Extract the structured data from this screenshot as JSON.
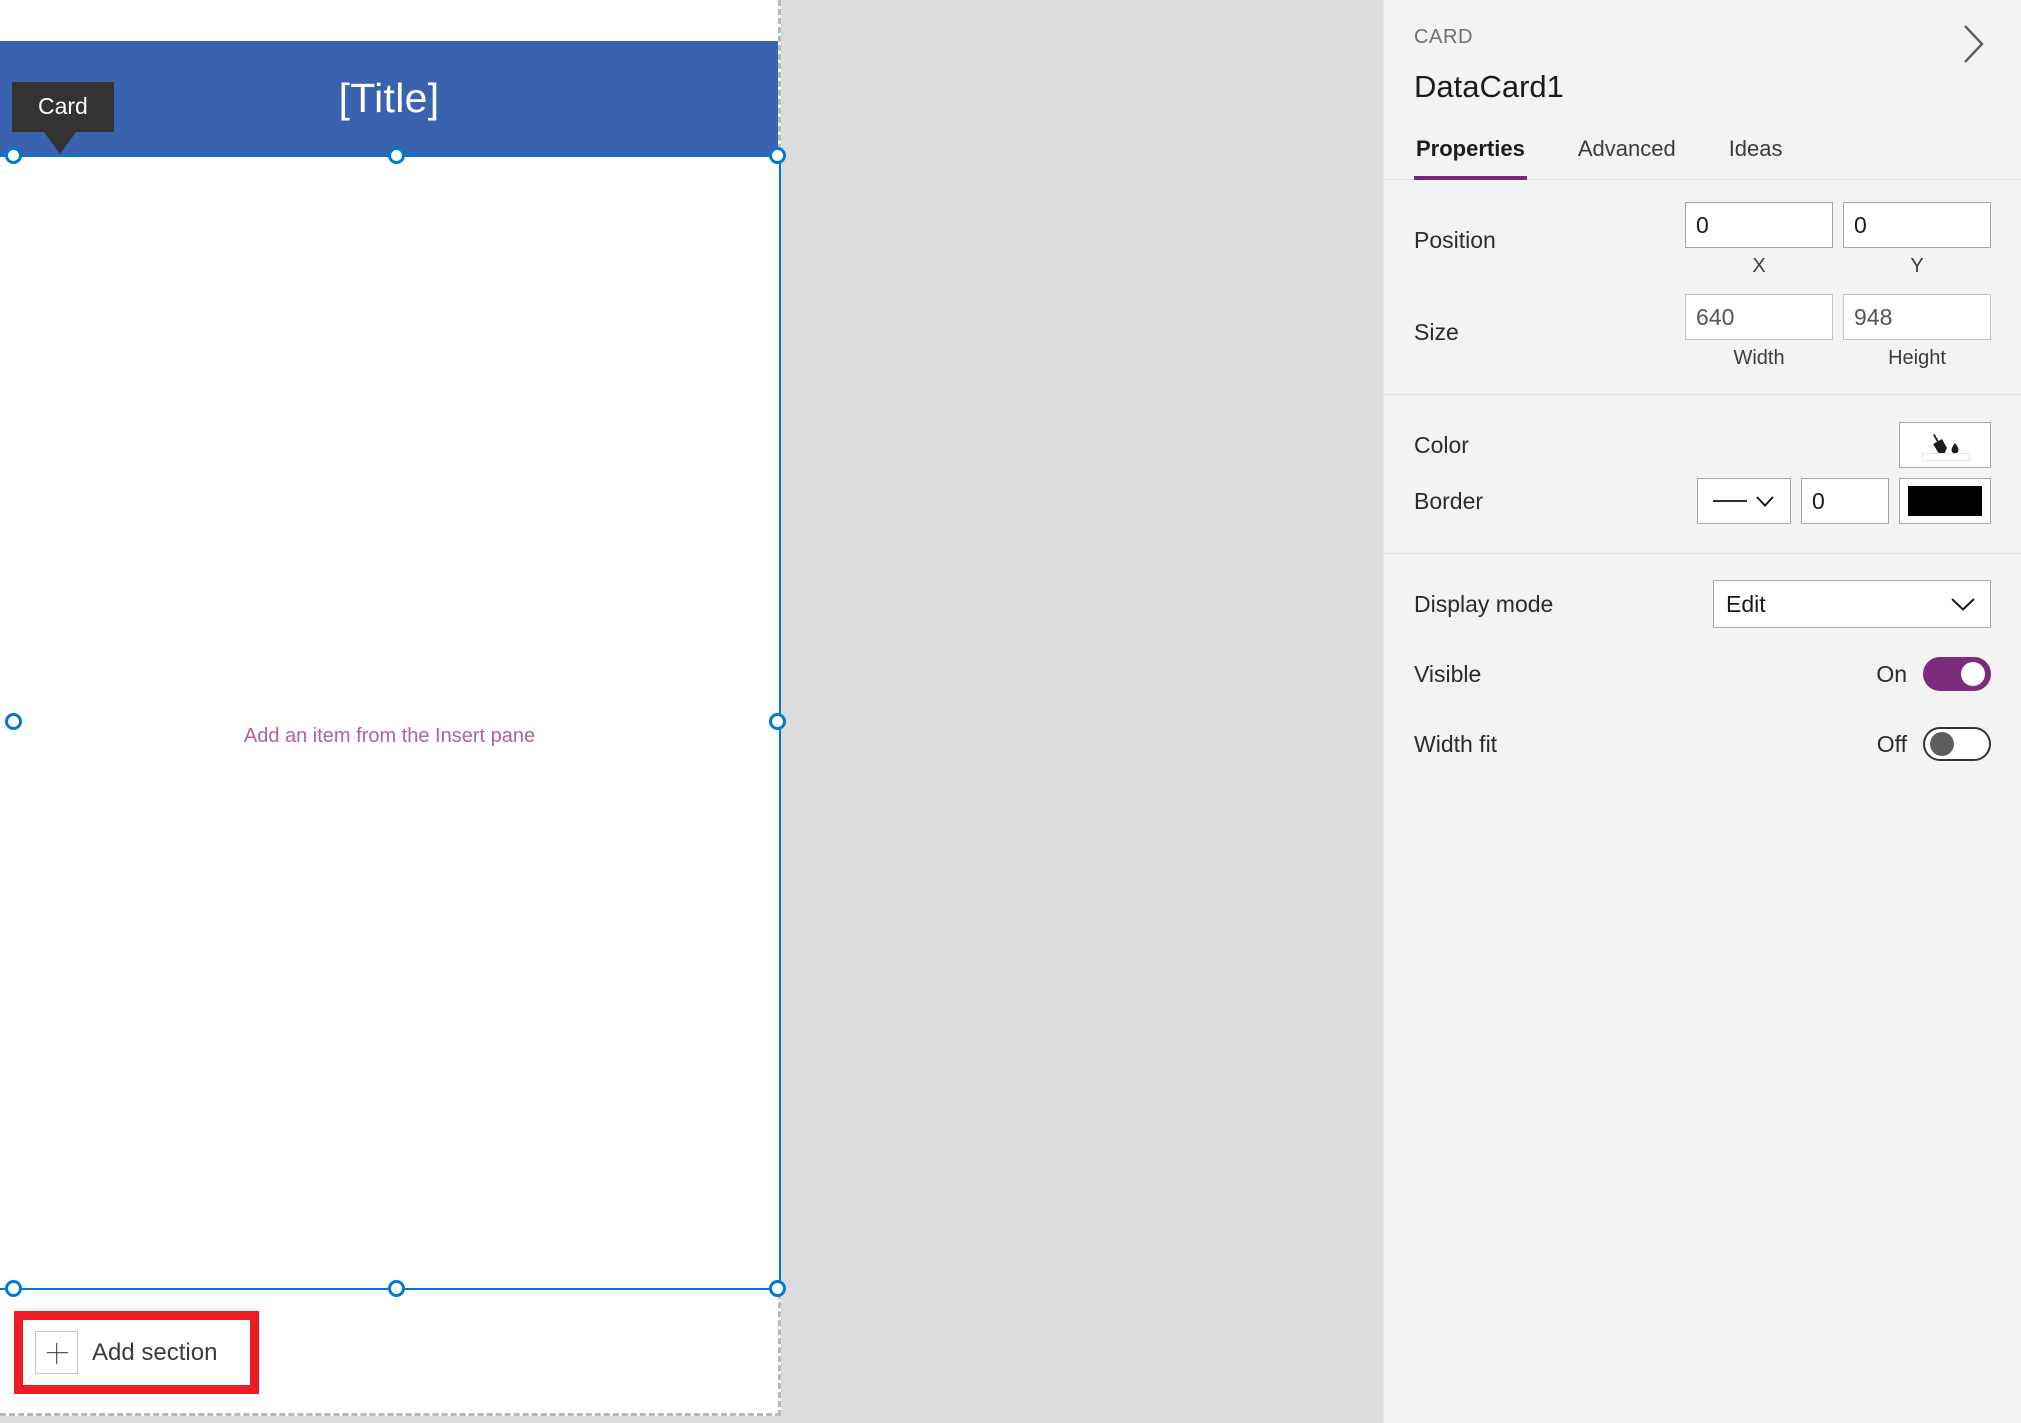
{
  "canvas": {
    "title_bar_text": "[Title]",
    "title_bar_color": "#3a62ae",
    "card_badge_label": "Card",
    "card_placeholder": "Add an item from the Insert pane",
    "placeholder_color": "#b4619b",
    "add_section_label": "Add section",
    "plus_icon": "plus-icon",
    "highlight_color": "#ed1c24",
    "selection_color": "#0078d4"
  },
  "panel": {
    "kicker": "CARD",
    "title": "DataCard1",
    "collapse_icon": "chevron-right-icon",
    "accent_color": "#742774",
    "tabs": [
      {
        "label": "Properties",
        "active": true
      },
      {
        "label": "Advanced",
        "active": false
      },
      {
        "label": "Ideas",
        "active": false
      }
    ],
    "properties": {
      "position": {
        "label": "Position",
        "x_value": "0",
        "y_value": "0",
        "x_sublabel": "X",
        "y_sublabel": "Y"
      },
      "size": {
        "label": "Size",
        "width_value": "640",
        "height_value": "948",
        "width_sublabel": "Width",
        "height_sublabel": "Height"
      },
      "color": {
        "label": "Color",
        "icon": "paint-bucket-icon",
        "swatch_color": "#ffffff"
      },
      "border": {
        "label": "Border",
        "style": "solid",
        "style_icon": "chevron-down-icon",
        "thickness": "0",
        "color": "#000000"
      },
      "display_mode": {
        "label": "Display mode",
        "value": "Edit",
        "icon": "chevron-down-icon"
      },
      "visible": {
        "label": "Visible",
        "state": "On",
        "on": true
      },
      "width_fit": {
        "label": "Width fit",
        "state": "Off",
        "on": false
      }
    }
  }
}
